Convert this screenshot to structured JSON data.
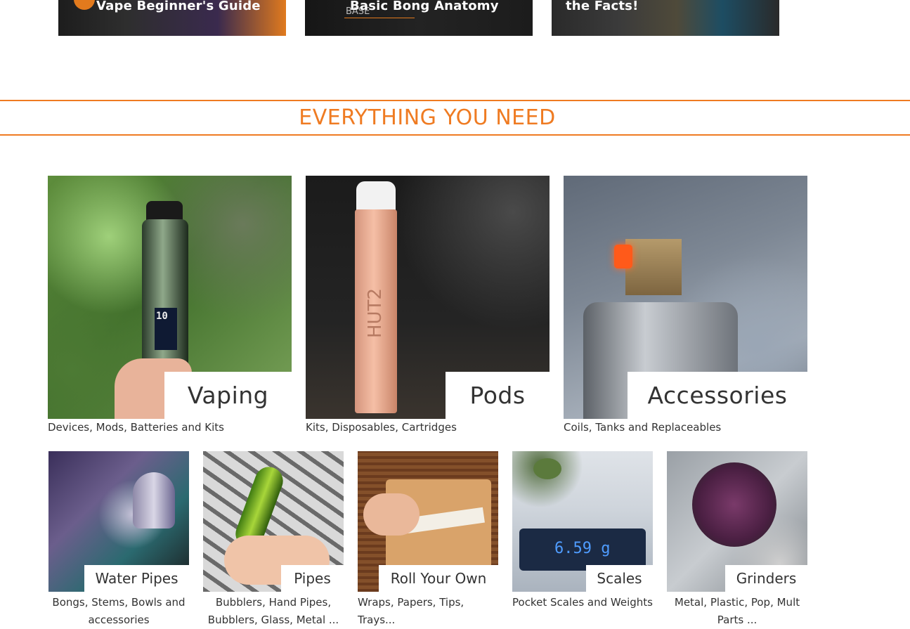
{
  "blog_cards": [
    {
      "title": "Vape Beginner's Guide"
    },
    {
      "title": "Basic Bong Anatomy",
      "overlay_text": "BASE"
    },
    {
      "title": "the Facts!"
    }
  ],
  "section": {
    "title": "EVERYTHING YOU NEED"
  },
  "categories_main": [
    {
      "label": "Vaping",
      "description": "Devices, Mods, Batteries and Kits",
      "device_screen": "10"
    },
    {
      "label": "Pods",
      "description": "Kits, Disposables, Cartridges",
      "device_text": "HUT2"
    },
    {
      "label": "Accessories",
      "description": "Coils, Tanks and Replaceables"
    }
  ],
  "categories_sub": [
    {
      "label": "Water Pipes",
      "description": "Bongs, Stems, Bowls and accessories"
    },
    {
      "label": "Pipes",
      "description": "Bubblers, Hand Pipes, Bubblers, Glass,  Metal ..."
    },
    {
      "label": "Roll Your Own",
      "description": "Wraps, Papers, Tips, Trays..."
    },
    {
      "label": "Scales",
      "description": "Pocket Scales and Weights",
      "scale_display": "6.59 g"
    },
    {
      "label": "Grinders",
      "description": "Metal, Plastic, Pop, Mult Parts ..."
    }
  ],
  "colors": {
    "accent": "#ef7b22",
    "text": "#333333"
  }
}
